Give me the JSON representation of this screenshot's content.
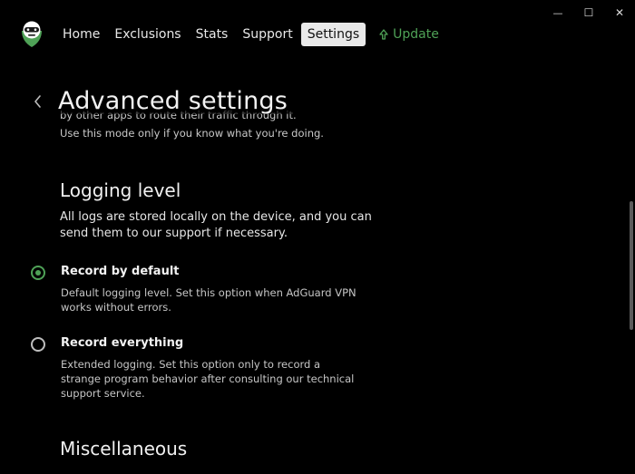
{
  "window": {
    "controls": {
      "minimize": "—",
      "maximize": "☐",
      "close": "✕"
    }
  },
  "header": {
    "nav": [
      {
        "label": "Home"
      },
      {
        "label": "Exclusions"
      },
      {
        "label": "Stats"
      },
      {
        "label": "Support"
      },
      {
        "label": "Settings",
        "active": true
      }
    ],
    "update_label": "Update",
    "update_color": "#4fa257"
  },
  "page": {
    "title": "Advanced settings",
    "cut_text_line1": "by other apps to route their traffic through it.",
    "cut_text_line2": "Use this mode only if you know what you're doing."
  },
  "logging": {
    "title": "Logging level",
    "description": "All logs are stored locally on the device, and you can send them to our support if necessary.",
    "options": [
      {
        "title": "Record by default",
        "description": "Default logging level. Set this option when AdGuard VPN works without errors.",
        "selected": true
      },
      {
        "title": "Record everything",
        "description": "Extended logging. Set this option only to record a strange program behavior after consulting our technical support service.",
        "selected": false
      }
    ]
  },
  "misc": {
    "title": "Miscellaneous"
  },
  "colors": {
    "accent": "#4fa257",
    "background": "#000000",
    "active_tab_bg": "#e9e9e9"
  }
}
